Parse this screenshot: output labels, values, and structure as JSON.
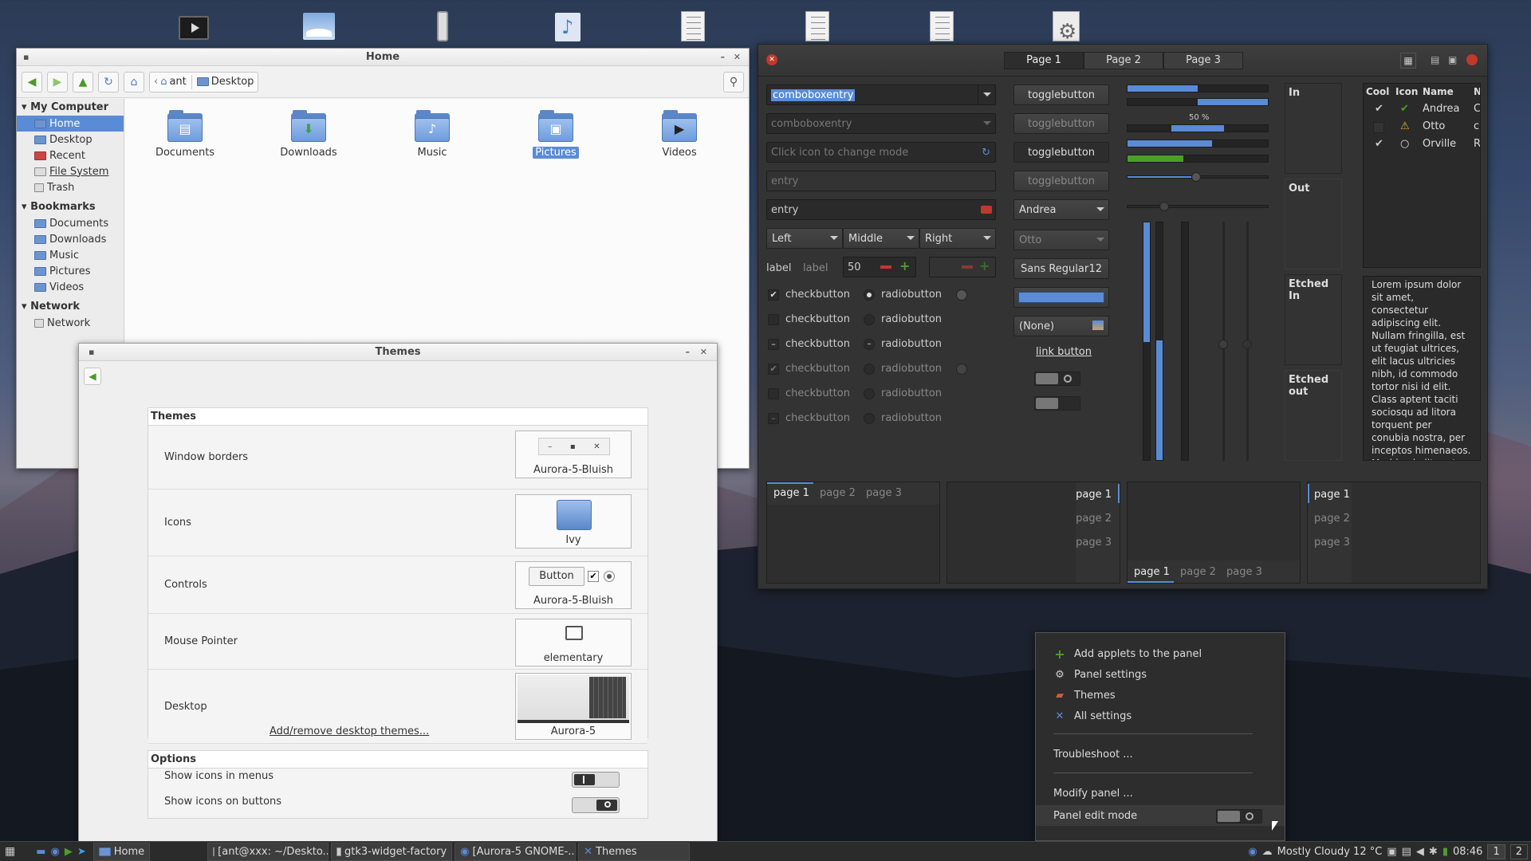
{
  "desktop": {
    "icons": [
      "terminal-icon",
      "image-viewer-icon",
      "usb-drive-icon",
      "music-file-icon",
      "text-document-icon",
      "text-document-icon",
      "text-document-icon",
      "settings-file-icon"
    ]
  },
  "files": {
    "title": "Home",
    "path": [
      "ant",
      "Desktop"
    ],
    "sidebar": {
      "my_computer": "My Computer",
      "places": [
        "Home",
        "Desktop",
        "Recent",
        "File System",
        "Trash"
      ],
      "bookmarks_header": "Bookmarks",
      "bookmarks": [
        "Documents",
        "Downloads",
        "Music",
        "Pictures",
        "Videos"
      ],
      "network_header": "Network",
      "network": [
        "Network"
      ]
    },
    "folders": [
      "Documents",
      "Downloads",
      "Music",
      "Pictures",
      "Videos"
    ]
  },
  "themes": {
    "title": "Themes",
    "section_themes": "Themes",
    "rows": [
      {
        "label": "Window borders",
        "value": "Aurora-5-Bluish"
      },
      {
        "label": "Icons",
        "value": "Ivy"
      },
      {
        "label": "Controls",
        "value": "Aurora-5-Bluish",
        "button": "Button"
      },
      {
        "label": "Mouse Pointer",
        "value": "elementary"
      },
      {
        "label": "Desktop",
        "value": "Aurora-5",
        "link": "Add/remove desktop themes..."
      }
    ],
    "section_options": "Options",
    "options": [
      {
        "label": "Show icons in menus"
      },
      {
        "label": "Show icons on buttons"
      }
    ]
  },
  "factory": {
    "tabs": [
      "Page 1",
      "Page 2",
      "Page 3"
    ],
    "combo1": "comboboxentry",
    "combo2": "comboboxentry",
    "icon_entry": "Click icon to change mode",
    "entry_insensitive": "entry",
    "entry": "entry",
    "combos": [
      "Left",
      "Middle",
      "Right"
    ],
    "label1": "label",
    "label2": "label",
    "spin": "50",
    "checks": [
      "checkbutton",
      "checkbutton",
      "checkbutton",
      "checkbutton",
      "checkbutton",
      "checkbutton"
    ],
    "radios": [
      "radiobutton",
      "radiobutton",
      "radiobutton",
      "radiobutton",
      "radiobutton",
      "radiobutton"
    ],
    "toggles": [
      "togglebutton",
      "togglebutton",
      "togglebutton",
      "togglebutton"
    ],
    "combo_name": "Andrea",
    "combo_name2": "Otto",
    "font": "Sans Regular",
    "font_size": "12",
    "file_chooser": "(None)",
    "link": "link button",
    "progress_label": "50 %",
    "progress_values": [
      0.5,
      0.5,
      0.38,
      0.6,
      0.4
    ],
    "frames": [
      "In",
      "Out",
      "Etched In",
      "Etched out"
    ],
    "tree_headers": [
      "Cool",
      "Icon",
      "Name",
      "N"
    ],
    "tree_rows": [
      {
        "name": "Andrea",
        "extra": "C",
        "cool": "✔",
        "icon": "✔"
      },
      {
        "name": "Otto",
        "extra": "cl",
        "cool": "",
        "icon": "⚠"
      },
      {
        "name": "Orville",
        "extra": "R",
        "cool": "✔",
        "icon": "○"
      }
    ],
    "lorem": "Lorem ipsum dolor sit amet, consectetur adipiscing elit. Nullam fringilla, est ut feugiat ultrices, elit lacus ultricies nibh, id commodo tortor nisi id elit. Class aptent taciti sociosqu ad litora torquent per conubia nostra, per inceptos himenaeos. Morbi vel elit erat.",
    "notebook_pages": [
      "page 1",
      "page 2",
      "page 3"
    ]
  },
  "panel_menu": {
    "items": [
      "Add applets to the panel",
      "Panel settings",
      "Themes",
      "All settings"
    ],
    "troubleshoot": "Troubleshoot ...",
    "modify": "Modify panel ...",
    "edit_mode": "Panel edit mode"
  },
  "taskbar": {
    "windows": [
      "Home",
      "[ant@xxx: ~/Deskto...",
      "gtk3-widget-factory",
      "[Aurora-5 GNOME-...",
      "Themes"
    ],
    "weather": "Mostly Cloudy 12 °C",
    "time": "08:46",
    "workspaces": [
      "1",
      "2"
    ]
  },
  "colors": {
    "accent": "#5a8bd6",
    "green": "#4aa02c",
    "dark_bg": "#333333"
  }
}
